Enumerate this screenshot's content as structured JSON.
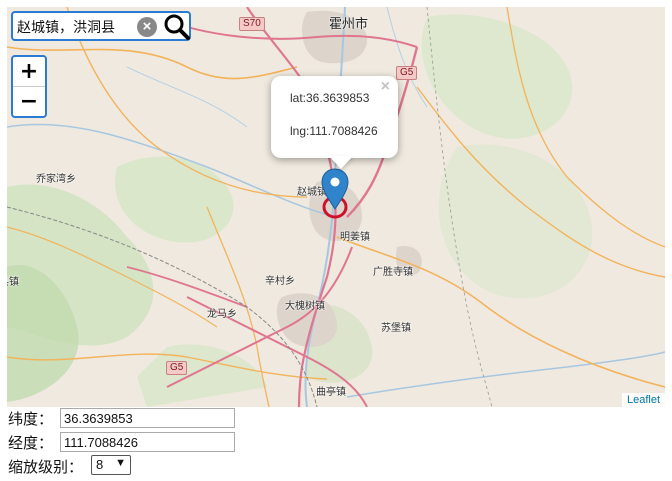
{
  "search": {
    "value": "赵城镇，洪洞县",
    "clear_icon": "close-circle-icon",
    "search_icon": "magnifier-icon"
  },
  "zoom": {
    "in_label": "+",
    "out_label": "−"
  },
  "popup": {
    "close_label": "×",
    "lat_text": "lat:36.3639853",
    "lng_text": "lng:111.7088426"
  },
  "attribution": "Leaflet",
  "map_labels": {
    "city": "霍州市",
    "zhaocheng": "赵城镇",
    "mingjiang": "明姜镇",
    "guangsheng": "广胜寺镇",
    "xincun": "辛村乡",
    "longma": "龙马乡",
    "dahuaishu": "大槐树镇",
    "subao": "苏堡镇",
    "quting": "曲亭镇",
    "qiaojiawan": "乔家湾乡",
    "edge": "县镇"
  },
  "road_shields": {
    "s70": "S70",
    "g5_top": "G5",
    "g5_bottom": "G5"
  },
  "colors": {
    "accent": "#2a7bd1",
    "marker": "#2f84cc",
    "ring": "#d0102a"
  },
  "form": {
    "lat_label": "纬度：",
    "lat_value": "36.3639853",
    "lng_label": "经度：",
    "lng_value": "111.7088426",
    "zoom_label": "缩放级别：",
    "zoom_value": "8"
  }
}
